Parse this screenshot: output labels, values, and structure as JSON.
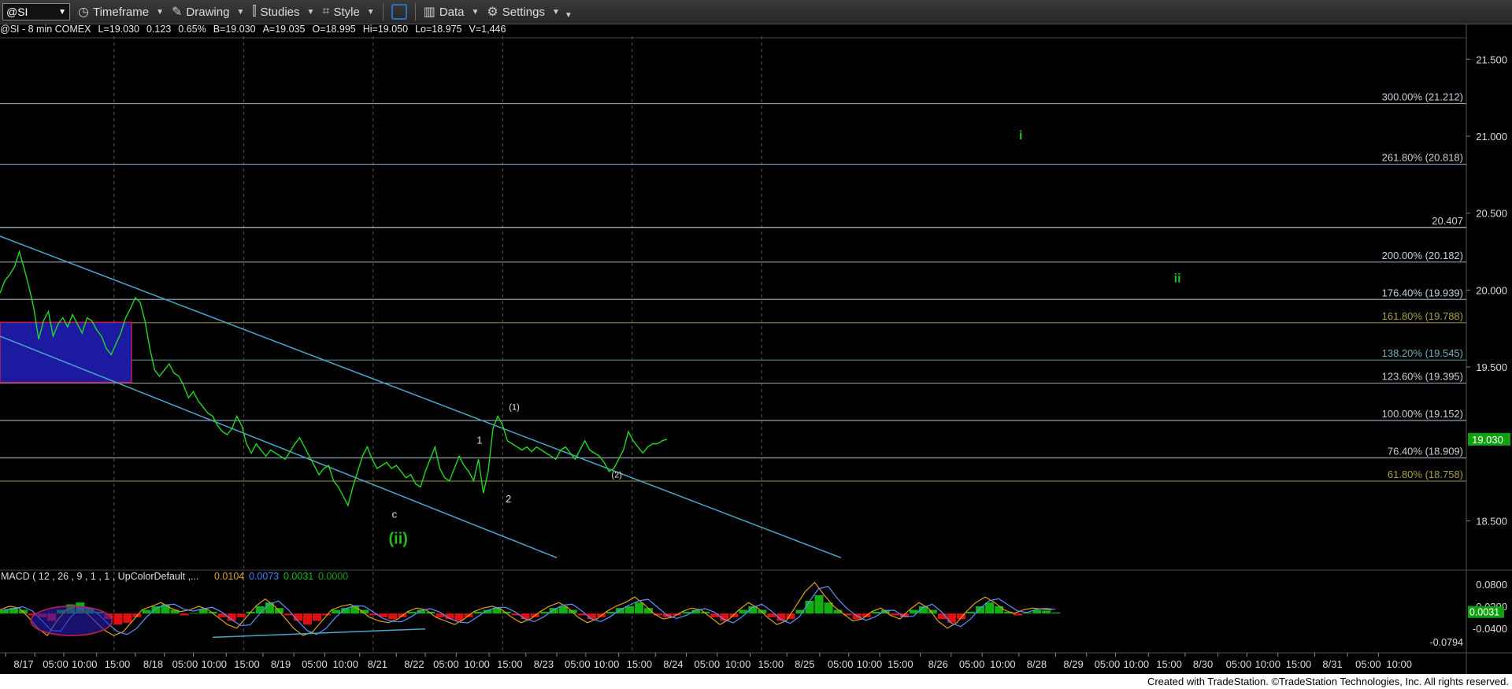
{
  "toolbar": {
    "symbol": "@SI",
    "items": [
      "Timeframe",
      "Drawing",
      "Studies",
      "Style",
      "Data",
      "Settings"
    ],
    "icons": [
      "clock-icon",
      "pencil-icon",
      "studies-icon",
      "style-icon",
      "layout-icon",
      "data-icon",
      "gear-icon"
    ]
  },
  "infobar": {
    "symbol_desc": "@SI - 8 min  COMEX",
    "last": "L=19.030",
    "change": "0.123",
    "pct": "0.65%",
    "bid": "B=19.030",
    "ask": "A=19.035",
    "open": "O=18.995",
    "high": "Hi=19.050",
    "low": "Lo=18.975",
    "volume": "V=1,446"
  },
  "colors": {
    "price": "#22d922",
    "label_green": "#1fbf1f",
    "channel": "#4aa6c8",
    "level_line": "#8aa0b0",
    "gold_line": "#7a7a34",
    "teal_line": "#3f7f86",
    "macd_up": "#10b010",
    "macd_down": "#e01010",
    "box_fill": "#1c1aa0",
    "box_border": "#c02050"
  },
  "chart_data": [
    {
      "type": "line",
      "title": "",
      "ylim": [
        18.2,
        21.65
      ],
      "y_ticks": [
        "21.500",
        "21.000",
        "20.500",
        "20.000",
        "19.500",
        "18.500"
      ],
      "y_tick_values": [
        21.5,
        21.0,
        20.5,
        20.0,
        19.5,
        18.5
      ],
      "last_price_label": "19.030",
      "last_price": 19.03,
      "x_labels": [
        "8/17",
        "05:00",
        "10:00",
        "15:00",
        "8/18",
        "05:00",
        "10:00",
        "15:00",
        "8/19",
        "05:00",
        "10:00",
        "8/21",
        "8/22",
        "05:00",
        "10:00",
        "15:00",
        "8/23",
        "05:00",
        "10:00",
        "15:00",
        "8/24",
        "05:00",
        "10:00",
        "15:00",
        "8/25",
        "05:00",
        "10:00",
        "15:00",
        "8/26",
        "05:00",
        "10:00",
        "8/28",
        "8/29",
        "05:00",
        "10:00",
        "15:00",
        "8/30",
        "05:00",
        "10:00",
        "15:00",
        "8/31",
        "05:00",
        "10:00"
      ],
      "x_label_bars": [
        3,
        18,
        33,
        50,
        70,
        85,
        100,
        117,
        136,
        152,
        168,
        186,
        205,
        220,
        236,
        253,
        272,
        288,
        303,
        320,
        339,
        355,
        371,
        388,
        407,
        424,
        439,
        455,
        476,
        492,
        508,
        527,
        546,
        562,
        577,
        594,
        613,
        630,
        645,
        661,
        680,
        697,
        713
      ],
      "session_dividers": [
        59,
        126,
        193,
        260,
        327,
        394
      ],
      "price_series": [
        19.98,
        20.06,
        20.1,
        20.15,
        20.25,
        20.14,
        20.02,
        19.88,
        19.68,
        19.8,
        19.86,
        19.7,
        19.78,
        19.82,
        19.76,
        19.84,
        19.78,
        19.72,
        19.82,
        19.8,
        19.74,
        19.7,
        19.62,
        19.58,
        19.65,
        19.72,
        19.82,
        19.88,
        19.95,
        19.92,
        19.8,
        19.62,
        19.48,
        19.44,
        19.48,
        19.52,
        19.46,
        19.44,
        19.38,
        19.3,
        19.34,
        19.28,
        19.24,
        19.2,
        19.18,
        19.12,
        19.08,
        19.06,
        19.1,
        19.18,
        19.12,
        19.0,
        18.94,
        19.0,
        18.96,
        18.92,
        18.96,
        18.94,
        18.92,
        18.9,
        18.95,
        19.0,
        19.04,
        18.98,
        18.92,
        18.86,
        18.8,
        18.84,
        18.86,
        18.76,
        18.72,
        18.66,
        18.6,
        18.72,
        18.82,
        18.92,
        18.98,
        18.9,
        18.84,
        18.86,
        18.88,
        18.84,
        18.86,
        18.82,
        18.78,
        18.8,
        18.74,
        18.72,
        18.82,
        18.9,
        18.98,
        18.84,
        18.78,
        18.76,
        18.84,
        18.92,
        18.86,
        18.82,
        18.76,
        18.9,
        18.68,
        18.82,
        19.1,
        19.18,
        19.12,
        19.02,
        19.0,
        18.98,
        18.96,
        18.98,
        18.95,
        18.98,
        18.96,
        18.94,
        18.92,
        18.9,
        18.96,
        18.98,
        18.94,
        18.9,
        18.96,
        19.02,
        18.96,
        18.94,
        18.92,
        18.88,
        18.82,
        18.84,
        18.9,
        18.96,
        19.08,
        19.02,
        18.98,
        18.94,
        18.98,
        19.0,
        19.0,
        19.02,
        19.03
      ],
      "channels": [
        {
          "x0": 0,
          "y0": 20.35,
          "x1": 435,
          "y1": 18.26
        },
        {
          "x0": 0,
          "y0": 19.7,
          "x1": 288,
          "y1": 18.26
        }
      ],
      "levels": [
        {
          "label": "300.00% (21.212)",
          "value": 21.212,
          "kind": "grey"
        },
        {
          "label": "261.80% (20.818)",
          "value": 20.818,
          "kind": "grey"
        },
        {
          "label": "20.407",
          "value": 20.407,
          "kind": "white"
        },
        {
          "label": "200.00% (20.182)",
          "value": 20.182,
          "kind": "grey"
        },
        {
          "label": "176.40% (19.939)",
          "value": 19.939,
          "kind": "grey"
        },
        {
          "label": "161.80% (19.788)",
          "value": 19.788,
          "kind": "gold"
        },
        {
          "label": "138.20% (19.545)",
          "value": 19.545,
          "kind": "teal"
        },
        {
          "label": "123.60% (19.395)",
          "value": 19.395,
          "kind": "grey"
        },
        {
          "label": "100.00% (19.152)",
          "value": 19.152,
          "kind": "grey"
        },
        {
          "label": "76.40% (18.909)",
          "value": 18.909,
          "kind": "grey"
        },
        {
          "label": "61.80% (18.758)",
          "value": 18.758,
          "kind": "gold"
        }
      ],
      "box": {
        "x0": 0,
        "x1": 68,
        "y_top": 19.79,
        "y_bottom": 19.4
      },
      "wave_labels": [
        {
          "text": "i",
          "bar": 528,
          "y": 20.98,
          "style": "green"
        },
        {
          "text": "ii",
          "bar": 609,
          "y": 20.05,
          "style": "green"
        },
        {
          "text": "c",
          "bar": 204,
          "y": 18.52,
          "style": "white"
        },
        {
          "text": "(ii)",
          "bar": 206,
          "y": 18.35,
          "style": "green-big"
        },
        {
          "text": "1",
          "bar": 248,
          "y": 19.0,
          "style": "white"
        },
        {
          "text": "(1)",
          "bar": 266,
          "y": 19.22,
          "style": "white-small"
        },
        {
          "text": "2",
          "bar": 263,
          "y": 18.62,
          "style": "white"
        },
        {
          "text": "(2)",
          "bar": 319,
          "y": 18.78,
          "style": "white-small"
        }
      ]
    },
    {
      "type": "area",
      "title": "MACD ( 12 , 26 , 9 , 1 , 1 , UpColorDefault ,...",
      "readings": [
        "0.0104",
        "0.0073",
        "0.0031",
        "0.0000"
      ],
      "ylim": [
        -0.105,
        0.11
      ],
      "y_ticks": [
        "0.0800",
        "0.0200",
        "-0.0400"
      ],
      "y_tick_values": [
        0.08,
        0.02,
        -0.04
      ],
      "last_value_label": "0.0031",
      "last_value": 0.0031,
      "low_label": "-0.0794",
      "low_value": -0.0794,
      "divergence_line": {
        "x0": 110,
        "y0": -0.065,
        "x1": 220,
        "y1": -0.042
      },
      "ellipse": {
        "cx": 37,
        "rx": 21,
        "cy": -0.02,
        "ry": 0.04
      },
      "histogram": [
        0.01,
        0.015,
        0.01,
        -0.005,
        -0.01,
        -0.02,
        0.01,
        0.025,
        0.03,
        0.015,
        0.005,
        -0.015,
        -0.03,
        -0.025,
        -0.01,
        0.01,
        0.02,
        0.025,
        0.01,
        -0.005,
        0.002,
        0.012,
        0.005,
        -0.01,
        -0.02,
        -0.01,
        0.005,
        0.02,
        0.03,
        0.015,
        -0.005,
        -0.02,
        -0.03,
        -0.02,
        -0.005,
        0.01,
        0.015,
        0.02,
        0.01,
        -0.005,
        -0.01,
        -0.015,
        -0.01,
        0.005,
        0.01,
        0.005,
        -0.01,
        -0.015,
        -0.02,
        -0.01,
        0.005,
        0.01,
        0.015,
        0.005,
        -0.005,
        -0.015,
        -0.01,
        0.005,
        0.015,
        0.02,
        0.01,
        -0.005,
        -0.015,
        -0.01,
        0.005,
        0.015,
        0.02,
        0.03,
        0.015,
        -0.005,
        -0.01,
        -0.005,
        0.005,
        0.01,
        0.005,
        -0.01,
        -0.02,
        -0.01,
        0.01,
        0.02,
        0.01,
        -0.01,
        -0.02,
        -0.015,
        0.01,
        0.035,
        0.05,
        0.03,
        0.01,
        -0.005,
        -0.015,
        -0.01,
        0.005,
        0.01,
        -0.005,
        -0.01,
        0.01,
        0.02,
        0.01,
        -0.015,
        -0.025,
        -0.015,
        0.005,
        0.02,
        0.03,
        0.02,
        0.005,
        -0.005,
        0.003,
        0.01,
        0.008,
        0.003
      ],
      "macd_line": [
        0.01,
        0.02,
        0.015,
        -0.01,
        -0.04,
        -0.06,
        -0.02,
        0.01,
        0.02,
        0.005,
        -0.02,
        -0.045,
        -0.06,
        -0.05,
        -0.02,
        0.01,
        0.02,
        0.03,
        0.015,
        0.005,
        0.01,
        0.02,
        0.01,
        -0.01,
        -0.03,
        -0.04,
        -0.01,
        0.02,
        0.04,
        0.02,
        -0.01,
        -0.04,
        -0.06,
        -0.05,
        -0.02,
        0.01,
        0.02,
        0.025,
        0.01,
        -0.01,
        -0.02,
        -0.025,
        -0.015,
        0.005,
        0.015,
        0.01,
        -0.01,
        -0.02,
        -0.03,
        -0.015,
        0.005,
        0.015,
        0.02,
        0.01,
        -0.01,
        -0.025,
        -0.015,
        0.005,
        0.02,
        0.03,
        0.015,
        -0.01,
        -0.025,
        -0.015,
        0.005,
        0.02,
        0.03,
        0.045,
        0.025,
        0.0,
        -0.015,
        -0.01,
        0.005,
        0.015,
        0.01,
        -0.01,
        -0.03,
        -0.015,
        0.01,
        0.03,
        0.015,
        -0.01,
        -0.03,
        -0.02,
        0.02,
        0.06,
        0.085,
        0.05,
        0.02,
        0.0,
        -0.02,
        -0.015,
        0.005,
        0.015,
        -0.005,
        -0.015,
        0.01,
        0.03,
        0.015,
        -0.02,
        -0.04,
        -0.025,
        0.005,
        0.03,
        0.045,
        0.03,
        0.01,
        0.0,
        0.01,
        0.015,
        0.012,
        0.0104
      ]
    }
  ],
  "footer": {
    "text": "Created with TradeStation. ©TradeStation Technologies, Inc. All rights reserved."
  }
}
